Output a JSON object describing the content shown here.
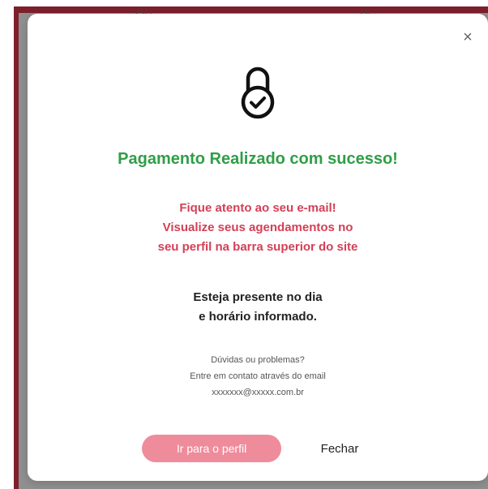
{
  "background": {
    "text_left": "OU",
    "text_right": "Ul"
  },
  "modal": {
    "close_label": "×",
    "lock_icon": "lock-check-icon",
    "title": "Pagamento Realizado com sucesso!",
    "notice_lines": [
      "Fique atento ao seu e-mail!",
      "Visualize seus agendamentos no",
      "seu perfil na barra superior do site"
    ],
    "presence_lines": [
      "Esteja presente no dia",
      "e horário informado."
    ],
    "help_lines": [
      "Dúvidas ou problemas?",
      "Entre em contato através do email",
      "xxxxxxx@xxxxx.com.br"
    ],
    "profile_button_label": "Ir para o perfil",
    "close_button_label": "Fechar"
  },
  "colors": {
    "title": "#2f9e47",
    "notice": "#d43f56",
    "profile_button": "#ef8c9c",
    "backdrop": "#8f8f8f",
    "frame": "#7e1f2c"
  }
}
